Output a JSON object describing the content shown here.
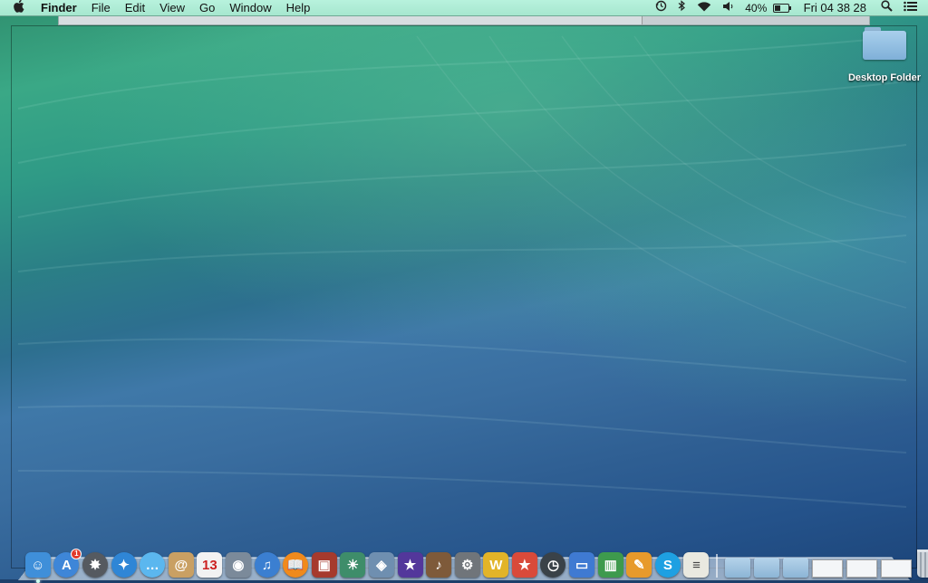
{
  "menubar": {
    "apple_icon": "apple-icon",
    "app_name": "Finder",
    "menus": [
      "File",
      "Edit",
      "View",
      "Go",
      "Window",
      "Help"
    ],
    "status": {
      "time_machine_icon": "time-machine-icon",
      "bluetooth_icon": "bluetooth-icon",
      "wifi_icon": "wifi-icon",
      "volume_icon": "volume-icon",
      "battery_percent": "40%",
      "battery_level": 0.4,
      "clock": "Fri 04 38 28",
      "spotlight_icon": "spotlight-search-icon",
      "notification_icon": "notification-center-icon"
    }
  },
  "desktop": {
    "folder_label": "Desktop Folder"
  },
  "dock": {
    "apps": [
      {
        "name": "finder-icon",
        "glyph": "☺",
        "color": "#3f8fd9",
        "running": true
      },
      {
        "name": "app-store-icon",
        "glyph": "A",
        "color": "#3e86d8",
        "badge": "1",
        "round": true
      },
      {
        "name": "launchpad-icon",
        "glyph": "✸",
        "color": "#555a60",
        "round": true
      },
      {
        "name": "safari-icon",
        "glyph": "✦",
        "color": "#2f86d6",
        "round": true
      },
      {
        "name": "messages-icon",
        "glyph": "…",
        "color": "#5bb7ef",
        "round": true
      },
      {
        "name": "contacts-icon",
        "glyph": "@",
        "color": "#c9a063"
      },
      {
        "name": "calendar-icon",
        "glyph": "13",
        "color": "#f2f2f2",
        "text": "#c22"
      },
      {
        "name": "photo-booth-icon",
        "glyph": "◉",
        "color": "#7b8a9a"
      },
      {
        "name": "itunes-icon",
        "glyph": "♫",
        "color": "#3b7fd1",
        "round": true
      },
      {
        "name": "ibooks-icon",
        "glyph": "📖",
        "color": "#f08a1c",
        "round": true
      },
      {
        "name": "photo-app-icon",
        "glyph": "▣",
        "color": "#a63a2d"
      },
      {
        "name": "iphoto-icon",
        "glyph": "☀",
        "color": "#3e8d6a"
      },
      {
        "name": "preview-icon",
        "glyph": "◈",
        "color": "#6f8fb0"
      },
      {
        "name": "imovie-icon",
        "glyph": "★",
        "color": "#53379b"
      },
      {
        "name": "garageband-icon",
        "glyph": "♪",
        "color": "#7e5a3a"
      },
      {
        "name": "system-utility-icon",
        "glyph": "⚙",
        "color": "#70757a"
      },
      {
        "name": "word-app-icon",
        "glyph": "W",
        "color": "#e2b428"
      },
      {
        "name": "wunderlist-icon",
        "glyph": "★",
        "color": "#d94a3a"
      },
      {
        "name": "time-machine-icon",
        "glyph": "◷",
        "color": "#3a4248",
        "round": true
      },
      {
        "name": "keynote-icon",
        "glyph": "▭",
        "color": "#3f7ad2"
      },
      {
        "name": "numbers-icon",
        "glyph": "▥",
        "color": "#3e9a4d"
      },
      {
        "name": "pages-icon",
        "glyph": "✎",
        "color": "#e79a2b"
      },
      {
        "name": "skype-icon",
        "glyph": "S",
        "color": "#1ea0e2",
        "round": true
      },
      {
        "name": "textedit-icon",
        "glyph": "≡",
        "color": "#e9e9e0",
        "text": "#444"
      }
    ]
  }
}
